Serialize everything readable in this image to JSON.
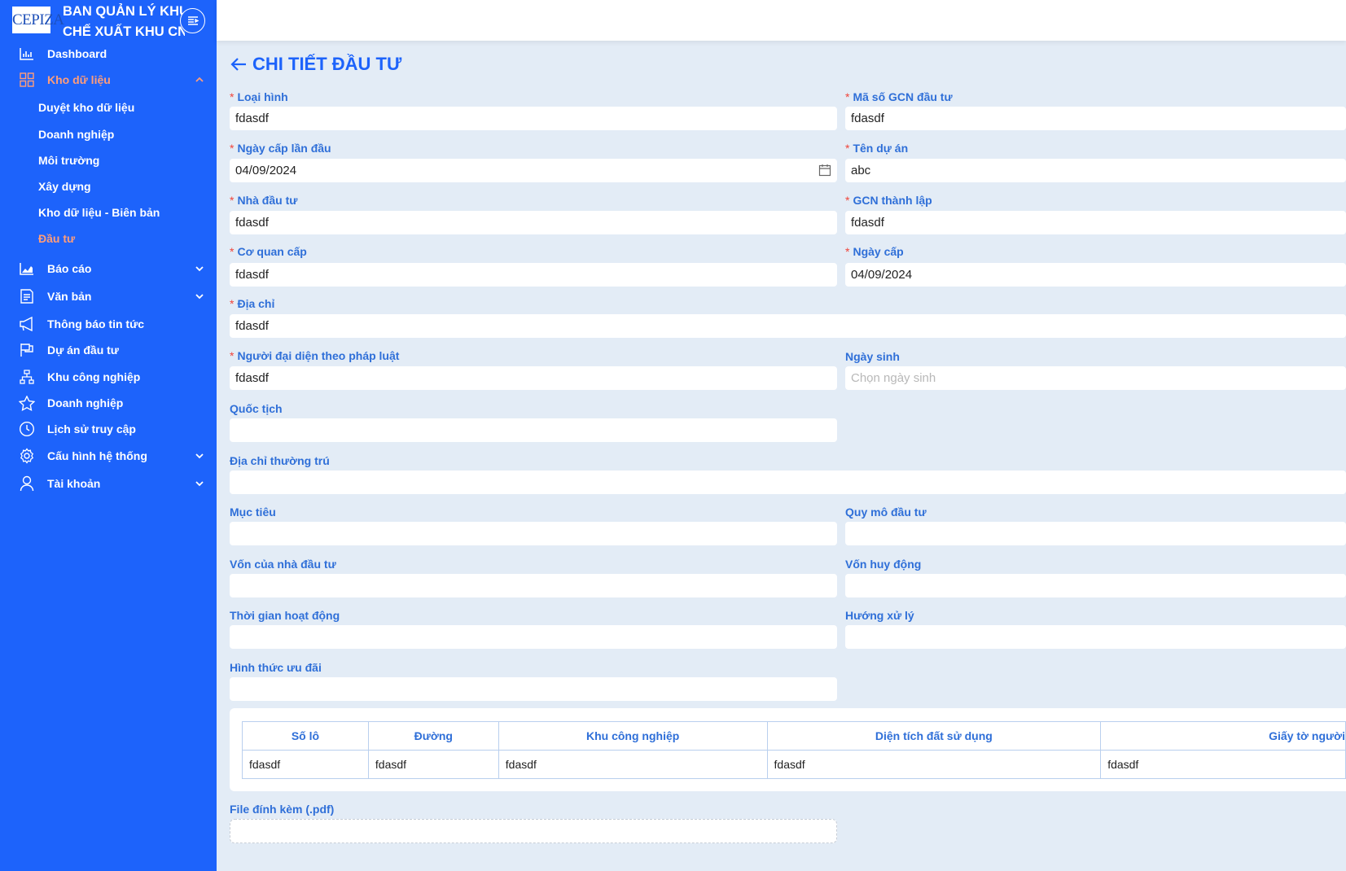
{
  "brand": {
    "logo_text": "CEPIZA",
    "title_line1": "BAN QUẢN LÝ KHU",
    "title_line2": "CHẾ XUẤT KHU CN"
  },
  "colors": {
    "sidebar": "#1d63fb",
    "active": "#ff9d7a",
    "accent": "#2f6fd8",
    "required": "#f0443a"
  },
  "menu": {
    "dashboard": "Dashboard",
    "kho": "Kho dữ liệu",
    "kho_sub": [
      "Duyệt kho dữ liệu",
      "Doanh nghiệp",
      "Môi trường",
      "Xây dựng",
      "Kho dữ liệu - Biên bản",
      "Đầu tư"
    ],
    "baocao": "Báo cáo",
    "vanban": "Văn bản",
    "thongbao": "Thông báo tin tức",
    "duan": "Dự án đầu tư",
    "kcn": "Khu công nghiệp",
    "doanhnghiep": "Doanh nghiệp",
    "lichsu": "Lịch sử truy cập",
    "cauhinh": "Cấu hình hệ thống",
    "taikhoan": "Tài khoản"
  },
  "page": {
    "title": "CHI TIẾT ĐẦU TƯ"
  },
  "form": {
    "loai_hinh": {
      "label": "Loại hình",
      "value": "fdasdf"
    },
    "ma_so_gcn": {
      "label": "Mã số GCN đầu tư",
      "value": "fdasdf"
    },
    "ngay_cap_lan_dau": {
      "label": "Ngày cấp lần đầu",
      "value": "04/09/2024"
    },
    "ten_du_an": {
      "label": "Tên dự án",
      "value": "abc"
    },
    "nha_dau_tu": {
      "label": "Nhà đầu tư",
      "value": "fdasdf"
    },
    "gcn_thanh_lap": {
      "label": "GCN thành lập",
      "value": "fdasdf"
    },
    "co_quan_cap": {
      "label": "Cơ quan cấp",
      "value": "fdasdf"
    },
    "ngay_cap": {
      "label": "Ngày cấp",
      "value": "04/09/2024"
    },
    "dia_chi": {
      "label": "Địa chỉ",
      "value": "fdasdf"
    },
    "nguoi_dai_dien": {
      "label": "Người đại diện theo pháp luật",
      "value": "fdasdf"
    },
    "ngay_sinh": {
      "label": "Ngày sinh",
      "placeholder": "Chọn ngày sinh"
    },
    "quoc_tich": {
      "label": "Quốc tịch",
      "value": ""
    },
    "dia_chi_thuong_tru": {
      "label": "Địa chỉ thường trú",
      "value": ""
    },
    "muc_tieu": {
      "label": "Mục tiêu",
      "value": ""
    },
    "quy_mo": {
      "label": "Quy mô đầu tư",
      "value": ""
    },
    "von_nha_dau_tu": {
      "label": "Vốn của nhà đầu tư",
      "value": ""
    },
    "von_huy_dong": {
      "label": "Vốn huy động",
      "value": ""
    },
    "thoi_gian": {
      "label": "Thời gian hoạt động",
      "value": ""
    },
    "huong_xu_ly": {
      "label": "Hướng xử lý",
      "value": ""
    },
    "hinh_thuc": {
      "label": "Hình thức ưu đãi",
      "value": ""
    },
    "file": {
      "label": "File đính kèm (.pdf)"
    }
  },
  "table": {
    "headers": [
      "Số lô",
      "Đường",
      "Khu công nghiệp",
      "Diện tích đất sử dụng",
      "Giấy tờ người"
    ],
    "row": [
      "fdasdf",
      "fdasdf",
      "fdasdf",
      "fdasdf",
      "fdasdf"
    ]
  }
}
